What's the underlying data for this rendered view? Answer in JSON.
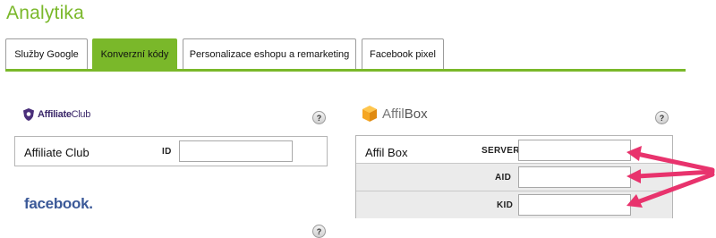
{
  "page": {
    "title": "Analytika"
  },
  "tabs": [
    {
      "label": "Služby Google"
    },
    {
      "label": "Konverzní kódy",
      "active": true
    },
    {
      "label": "Personalizace eshopu a remarketing"
    },
    {
      "label": "Facebook pixel"
    }
  ],
  "colors": {
    "accent": "#7ab82a",
    "arrow": "#e8336d",
    "affilbox_orange": "#f5a623",
    "facebook_blue": "#3b5998"
  },
  "affiliate_club": {
    "logo_text_bold": "Affiliate",
    "logo_text_rest": "Club",
    "row_label": "Affiliate Club",
    "id_label": "ID",
    "id_value": "",
    "help": "?"
  },
  "affilbox": {
    "logo_text_a": "Affil",
    "logo_text_b": "Box",
    "row_label": "Affil Box",
    "server_label": "SERVER",
    "aid_label": "AID",
    "kid_label": "KID",
    "server_value": "",
    "aid_value": "",
    "kid_value": "",
    "help": "?"
  },
  "facebook": {
    "logo_text": "facebook",
    "logo_dot": ".",
    "help": "?"
  }
}
